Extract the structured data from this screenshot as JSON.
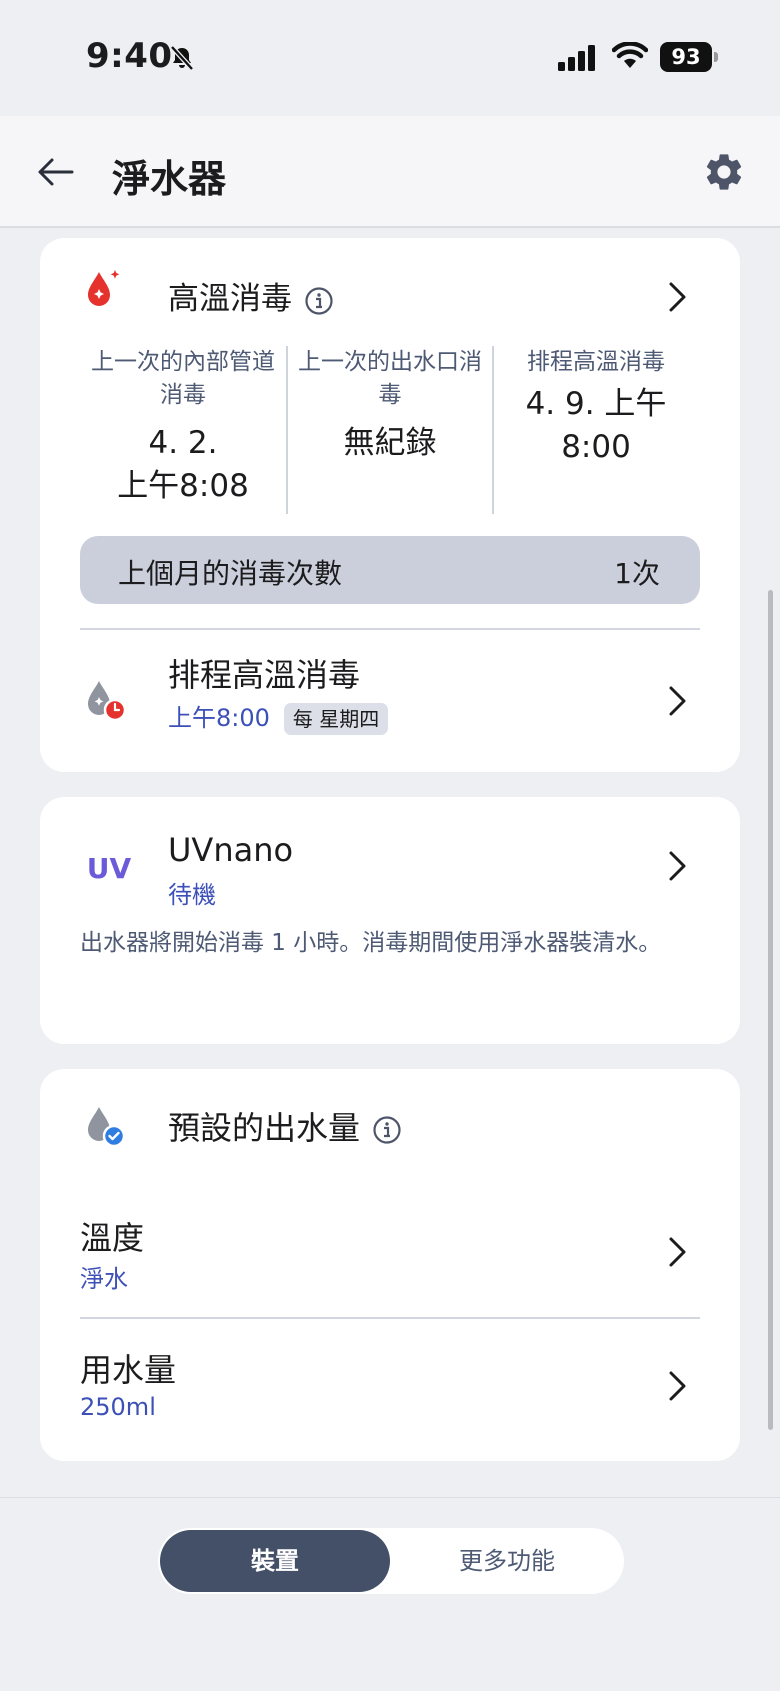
{
  "status_bar": {
    "time": "9:40",
    "battery": "93",
    "icons": [
      "bell-slash-icon",
      "cellular-signal-icon",
      "wifi-icon",
      "battery-icon"
    ]
  },
  "header": {
    "title": "淨水器",
    "back_icon": "arrow-left-icon",
    "settings_icon": "gear-icon"
  },
  "sterilization": {
    "title": "高溫消毒",
    "icon": "droplet-sparkle-icon",
    "stats": [
      {
        "label": "上一次的內部管道消毒",
        "value": "4. 2.\n上午8:08"
      },
      {
        "label": "上一次的出水口消毒",
        "value": "無紀錄"
      },
      {
        "label": "排程高溫消毒",
        "value": "4. 9. 上午8:00"
      }
    ],
    "monthly_count_label": "上個月的消毒次數",
    "monthly_count_value": "1次",
    "schedule": {
      "title": "排程高溫消毒",
      "time": "上午8:00",
      "repeat_tag": "每 星期四"
    }
  },
  "uvnano": {
    "logo": "UV",
    "title": "UVnano",
    "status": "待機",
    "description": "出水器將開始消毒 1 小時。消毒期間使用淨水器裝清水。"
  },
  "preset": {
    "title": "預設的出水量",
    "icon": "droplet-check-icon",
    "temperature_label": "溫度",
    "temperature_value": "淨水",
    "volume_label": "用水量",
    "volume_value": "250ml"
  },
  "bottom_tabs": {
    "active": "裝置",
    "inactive": "更多功能"
  },
  "colors": {
    "accent_text": "#3c50b8",
    "uv_purple": "#6b5bd9",
    "sterilize_red": "#e5322d",
    "tab_active": "#435068"
  }
}
